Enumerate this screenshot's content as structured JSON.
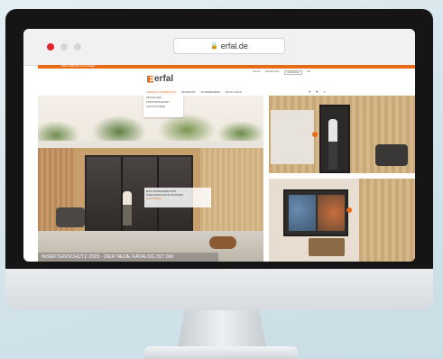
{
  "browser": {
    "url": "erfal.de"
  },
  "site": {
    "topbar_text": "ERFAL SERVICE Jetzt anfragen",
    "utility_links": [
      "Service",
      "Händlersuche",
      "Händlerlogin",
      "DE"
    ],
    "logo_text": "erfal",
    "nav_items": [
      "DESIGN & INSPIRATION",
      "PRODUKTE",
      "UNTERNEHMEN",
      "BLOG & INFO"
    ],
    "dropdown_items": [
      "DESIGNLINIEN",
      "INSPIRATIONSSEITEN",
      "SCHUTZSYSTEME"
    ],
    "hero_caption_lines": [
      "MAXI MASSGEFERTIGTE",
      "INSEKTENSCHUTZLÖSUNGEN"
    ],
    "hero_caption_link": "Jetzt erfahren",
    "hero_banner": "INSEKTENSCHUTZ 2025 - DER NEUE KATALOG IST DA!"
  },
  "colors": {
    "accent": "#ea6b16",
    "close_dot": "#e0262d"
  }
}
